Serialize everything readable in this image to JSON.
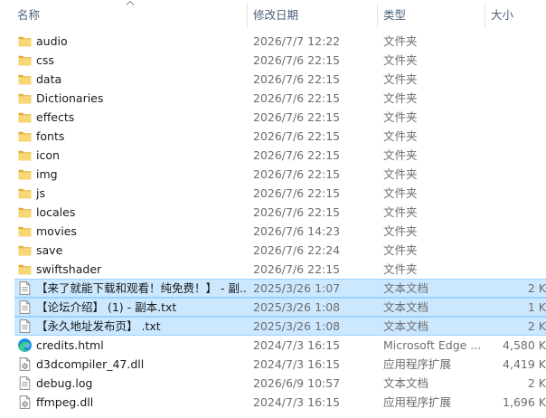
{
  "columns": {
    "name": "名称",
    "date": "修改日期",
    "type": "类型",
    "size": "大小"
  },
  "files": [
    {
      "name": "audio",
      "date": "2026/7/7 12:22",
      "type": "文件夹",
      "size": "",
      "icon": "folder-icon",
      "selected": false
    },
    {
      "name": "css",
      "date": "2026/7/6 22:15",
      "type": "文件夹",
      "size": "",
      "icon": "folder-icon",
      "selected": false
    },
    {
      "name": "data",
      "date": "2026/7/6 22:15",
      "type": "文件夹",
      "size": "",
      "icon": "folder-icon",
      "selected": false
    },
    {
      "name": "Dictionaries",
      "date": "2026/7/6 22:15",
      "type": "文件夹",
      "size": "",
      "icon": "folder-icon",
      "selected": false
    },
    {
      "name": "effects",
      "date": "2026/7/6 22:15",
      "type": "文件夹",
      "size": "",
      "icon": "folder-icon",
      "selected": false
    },
    {
      "name": "fonts",
      "date": "2026/7/6 22:15",
      "type": "文件夹",
      "size": "",
      "icon": "folder-icon",
      "selected": false
    },
    {
      "name": "icon",
      "date": "2026/7/6 22:15",
      "type": "文件夹",
      "size": "",
      "icon": "folder-icon",
      "selected": false
    },
    {
      "name": "img",
      "date": "2026/7/6 22:15",
      "type": "文件夹",
      "size": "",
      "icon": "folder-icon",
      "selected": false
    },
    {
      "name": "js",
      "date": "2026/7/6 22:15",
      "type": "文件夹",
      "size": "",
      "icon": "folder-icon",
      "selected": false
    },
    {
      "name": "locales",
      "date": "2026/7/6 22:15",
      "type": "文件夹",
      "size": "",
      "icon": "folder-icon",
      "selected": false
    },
    {
      "name": "movies",
      "date": "2026/7/6 14:23",
      "type": "文件夹",
      "size": "",
      "icon": "folder-icon",
      "selected": false
    },
    {
      "name": "save",
      "date": "2026/7/6 22:24",
      "type": "文件夹",
      "size": "",
      "icon": "folder-icon",
      "selected": false
    },
    {
      "name": "swiftshader",
      "date": "2026/7/6 22:15",
      "type": "文件夹",
      "size": "",
      "icon": "folder-icon",
      "selected": false
    },
    {
      "name": "【来了就能下载和观看！纯免费！】 - 副...",
      "date": "2025/3/26 1:07",
      "type": "文本文档",
      "size": "2 K",
      "icon": "text-document-icon",
      "selected": true
    },
    {
      "name": "【论坛介绍】 (1) - 副本.txt",
      "date": "2025/3/26 1:08",
      "type": "文本文档",
      "size": "1 K",
      "icon": "text-document-icon",
      "selected": true
    },
    {
      "name": "【永久地址发布页】 .txt",
      "date": "2025/3/26 1:08",
      "type": "文本文档",
      "size": "2 K",
      "icon": "text-document-icon",
      "selected": true
    },
    {
      "name": "credits.html",
      "date": "2024/7/3 16:15",
      "type": "Microsoft Edge ...",
      "size": "4,580 K",
      "icon": "edge-icon",
      "selected": false
    },
    {
      "name": "d3dcompiler_47.dll",
      "date": "2024/7/3 16:15",
      "type": "应用程序扩展",
      "size": "4,419 K",
      "icon": "dll-icon",
      "selected": false
    },
    {
      "name": "debug.log",
      "date": "2026/6/9 10:57",
      "type": "文本文档",
      "size": "2 K",
      "icon": "text-document-icon",
      "selected": false
    },
    {
      "name": "ffmpeg.dll",
      "date": "2024/7/3 16:15",
      "type": "应用程序扩展",
      "size": "1,696 K",
      "icon": "dll-icon",
      "selected": false
    }
  ]
}
